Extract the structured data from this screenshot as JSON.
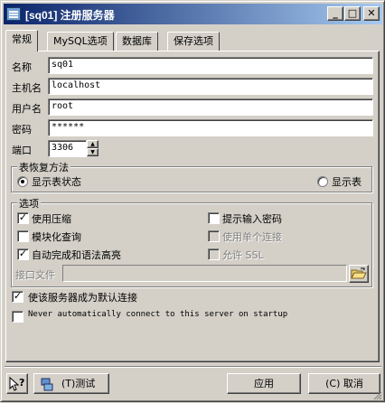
{
  "window": {
    "title": "[sq01] 注册服务器",
    "minimize": "_",
    "maximize": "□",
    "close": "✕"
  },
  "tabs": [
    {
      "label": "常规",
      "active": true
    },
    {
      "label": "MySQL选项",
      "active": false
    },
    {
      "label": "数据库",
      "active": false
    },
    {
      "label": "保存选项",
      "active": false
    }
  ],
  "general": {
    "name_label": "名称",
    "name_value": "sq01",
    "host_label": "主机名",
    "host_value": "localhost",
    "user_label": "用户名",
    "user_value": "root",
    "password_label": "密码",
    "password_value": "******",
    "port_label": "端口",
    "port_value": "3306"
  },
  "restore_group": {
    "title": "表恢复方法",
    "option_state": "显示表状态",
    "option_table": "显示表",
    "selected": "state"
  },
  "options_group": {
    "title": "选项",
    "use_compression": {
      "label": "使用压缩",
      "checked": true
    },
    "prompt_password": {
      "label": "提示输入密码",
      "checked": false
    },
    "modular_query": {
      "label": "模块化查询",
      "checked": false
    },
    "single_connection": {
      "label": "使用单个连接",
      "checked": false,
      "disabled": true
    },
    "autocomplete": {
      "label": "自动完成和语法高亮",
      "checked": true
    },
    "allow_ssl": {
      "label": "允许 SSL",
      "checked": false,
      "disabled": true
    },
    "interface_file_label": "接口文件",
    "interface_file_value": ""
  },
  "default_connection": {
    "label": "使该服务器成为默认连接",
    "checked": true
  },
  "never_auto_connect": {
    "label": "Never automatically connect to this server on startup",
    "checked": false
  },
  "footer": {
    "help_icon": "help-pointer-icon",
    "test_label": "(T)测试",
    "apply_label": "应用",
    "cancel_label": "(C) 取消"
  },
  "colors": {
    "titlebar_start": "#0a246a",
    "titlebar_end": "#a6caf0",
    "face": "#d4d0c8"
  }
}
